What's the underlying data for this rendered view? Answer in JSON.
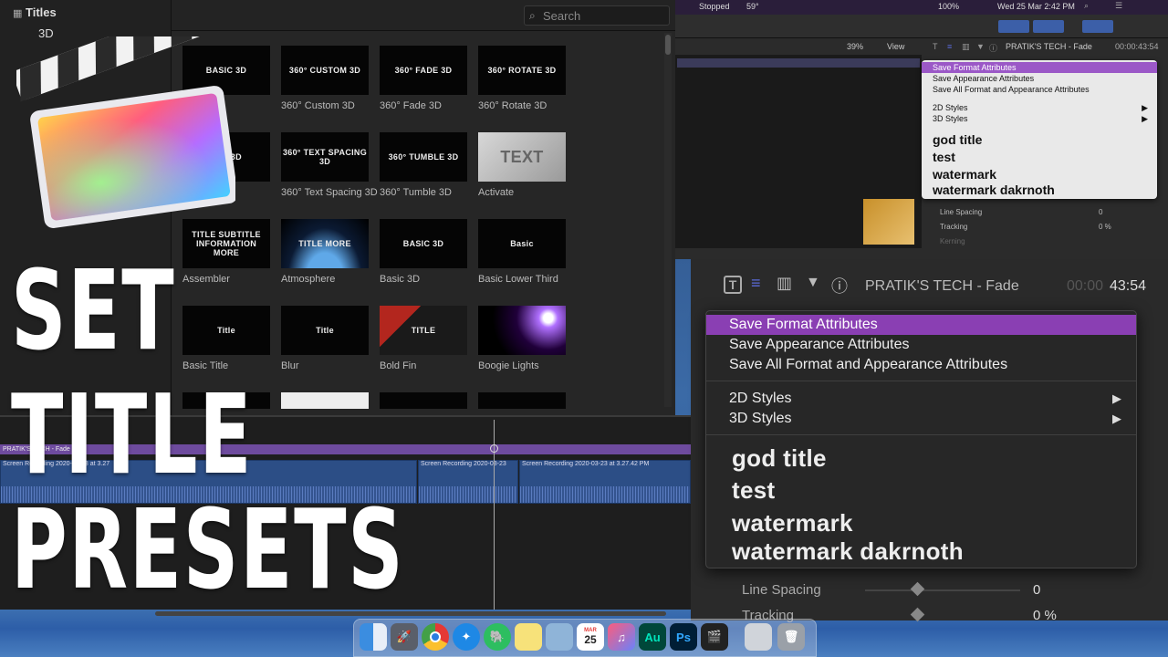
{
  "browser": {
    "sidebar_title": "Titles",
    "sidebar_item": "3D",
    "search_placeholder": "Search"
  },
  "titles": [
    {
      "thumb": "BASIC 3D",
      "label": "Basic 3D"
    },
    {
      "thumb": "360° CUSTOM 3D",
      "label": "360° Custom 3D"
    },
    {
      "thumb": "360° FADE 3D",
      "label": "360° Fade 3D"
    },
    {
      "thumb": "360° ROTATE 3D",
      "label": "360° Rotate 3D"
    },
    {
      "thumb": "BLE 3D",
      "label": "3D"
    },
    {
      "thumb": "360° TEXT SPACING 3D",
      "label": "360° Text Spacing 3D"
    },
    {
      "thumb": "360° TUMBLE 3D",
      "label": "360° Tumble 3D"
    },
    {
      "thumb": "TEXT",
      "label": "Activate"
    },
    {
      "thumb": "TITLE SUBTITLE INFORMATION MORE",
      "label": "Assembler"
    },
    {
      "thumb": "TITLE MORE",
      "label": "Atmosphere"
    },
    {
      "thumb": "BASIC 3D",
      "label": "Basic 3D"
    },
    {
      "thumb": "Basic",
      "label": "Basic Lower Third"
    },
    {
      "thumb": "Title",
      "label": "Basic Title"
    },
    {
      "thumb": "Title",
      "label": "Blur"
    },
    {
      "thumb": "TITLE",
      "label": "Bold Fin"
    },
    {
      "thumb": "",
      "label": "Boogie Lights"
    }
  ],
  "timeline": {
    "title_clip": "PRATIK'S TECH - Fade",
    "clips": [
      "Screen Recording 2020-03-23 at 3.27",
      "Screen Recording 2020-03-23",
      "Screen Recording 2020-03-23 at 3.27.42 PM"
    ]
  },
  "menubar": {
    "status": "Stopped",
    "temp": "59°",
    "battery": "100%",
    "datetime": "Wed 25 Mar  2:42 PM"
  },
  "mini": {
    "zoom": "39%",
    "view": "View",
    "inspector_title": "PRATIK'S TECH - Fade",
    "timecode": "00:00:43:54",
    "menu": {
      "save_format": "Save Format Attributes",
      "save_appearance": "Save Appearance Attributes",
      "save_all": "Save All Format and Appearance Attributes",
      "styles_2d": "2D Styles",
      "styles_3d": "3D Styles",
      "presets": [
        "god title",
        "test",
        "watermark",
        "watermark dakrnoth"
      ]
    },
    "line_spacing": "Line Spacing",
    "line_spacing_value": "0",
    "tracking": "Tracking",
    "tracking_value": "0 %",
    "kerning": "Kerning"
  },
  "zoom": {
    "inspector_title": "PRATIK'S TECH - Fade",
    "timecode_dim": "00:00",
    "timecode": "43:54",
    "menu": {
      "save_format": "Save Format Attributes",
      "save_appearance": "Save Appearance Attributes",
      "save_all": "Save All Format and Appearance Attributes",
      "styles_2d": "2D Styles",
      "styles_3d": "3D Styles",
      "presets": [
        "god title",
        "test",
        "watermark",
        "watermark dakrnoth"
      ]
    },
    "line_spacing": "Line Spacing",
    "line_spacing_value": "0",
    "tracking": "Tracking",
    "tracking_value": "0 %"
  },
  "overlay": {
    "line1": "SET",
    "line2": "TITLE",
    "line3": "PRESETS"
  },
  "dock": {
    "calendar_month": "MAR",
    "calendar_day": "25",
    "au": "Au",
    "ps": "Ps"
  },
  "colors": {
    "accent_purple": "#8a3fb3",
    "timeline_title": "#6e4b9e",
    "timeline_clip": "#2c4e86"
  }
}
